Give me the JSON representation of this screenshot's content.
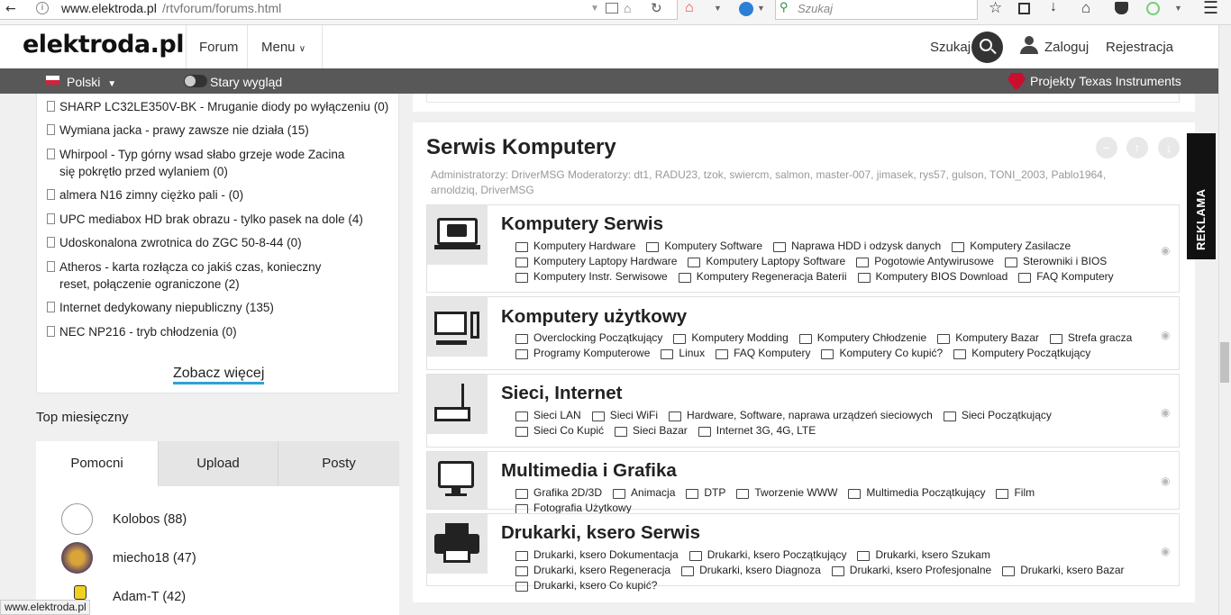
{
  "browser": {
    "url_host": "www.elektroda.pl",
    "url_path": "/rtvforum/forums.html",
    "search_placeholder": "Szukaj"
  },
  "header": {
    "logo": "elektroda.pl",
    "nav": [
      "Forum",
      "Menu"
    ],
    "search_label": "Szukaj",
    "login": "Zaloguj",
    "register": "Rejestracja"
  },
  "subbar": {
    "language": "Polski",
    "old_look": "Stary wygląd",
    "ti_link": "Projekty Texas Instruments"
  },
  "topics": [
    "SHARP LC32LE350V-BK - Mruganie diody po wyłączeniu (0)",
    "Wymiana jacka - prawy zawsze nie działa (15)",
    "Whirpool - Typ górny wsad słabo grzeje wode Zacina się pokrętło przed wylaniem (0)",
    "almera N16 zimny ciężko pali - (0)",
    "UPC mediabox HD brak obrazu - tylko pasek na dole (4)",
    "Udoskonalona zwrotnica do ZGC 50-8-44 (0)",
    "Atheros - karta rozłącza co jakiś czas, konieczny reset, połączenie ograniczone (2)",
    "Internet dedykowany niepubliczny (135)",
    "NEC NP216 - tryb chłodzenia (0)"
  ],
  "see_more": "Zobacz więcej",
  "top_monthly": {
    "title": "Top miesięczny",
    "tabs": [
      "Pomocni",
      "Upload",
      "Posty"
    ],
    "users": [
      "Kolobos (88)",
      "miecho18 (47)",
      "Adam-T (42)"
    ]
  },
  "status_url": "www.elektroda.pl",
  "section": {
    "title": "Serwis Komputery",
    "admins": "Administratorzy: DriverMSG Moderatorzy: dt1, RADU23, tzok, swiercm, salmon, master-007, jimasek, rys57, gulson, TONI_2003, Pablo1964, arnoldziq, DriverMSG"
  },
  "forums": [
    {
      "title": "Komputery Serwis",
      "subs": [
        "Komputery Hardware",
        "Komputery Software",
        "Naprawa HDD i odzysk danych",
        "Komputery Zasilacze",
        "Komputery Laptopy Hardware",
        "Komputery Laptopy Software",
        "Pogotowie Antywirusowe",
        "Sterowniki i BIOS",
        "Komputery Instr. Serwisowe",
        "Komputery Regeneracja Baterii",
        "Komputery BIOS Download",
        "FAQ Komputery"
      ]
    },
    {
      "title": "Komputery użytkowy",
      "subs": [
        "Overclocking Początkujący",
        "Komputery Modding",
        "Komputery Chłodzenie",
        "Komputery Bazar",
        "Strefa gracza",
        "Programy Komputerowe",
        "Linux",
        "FAQ Komputery",
        "Komputery Co kupić?",
        "Komputery Początkujący"
      ]
    },
    {
      "title": "Sieci, Internet",
      "subs": [
        "Sieci LAN",
        "Sieci WiFi",
        "Hardware, Software, naprawa urządzeń sieciowych",
        "Sieci Początkujący",
        "Sieci Co Kupić",
        "Sieci Bazar",
        "Internet 3G, 4G, LTE"
      ]
    },
    {
      "title": "Multimedia i Grafika",
      "subs": [
        "Grafika 2D/3D",
        "Animacja",
        "DTP",
        "Tworzenie WWW",
        "Multimedia Początkujący",
        "Film",
        "Fotografia Użytkowy"
      ]
    },
    {
      "title": "Drukarki, ksero Serwis",
      "subs": [
        "Drukarki, ksero Dokumentacja",
        "Drukarki, ksero Początkujący",
        "Drukarki, ksero Szukam",
        "Drukarki, ksero Regeneracja",
        "Drukarki, ksero Diagnoza",
        "Drukarki, ksero Profesjonalne",
        "Drukarki, ksero Bazar",
        "Drukarki, ksero Co kupić?"
      ]
    }
  ],
  "reklama": "REKLAMA"
}
